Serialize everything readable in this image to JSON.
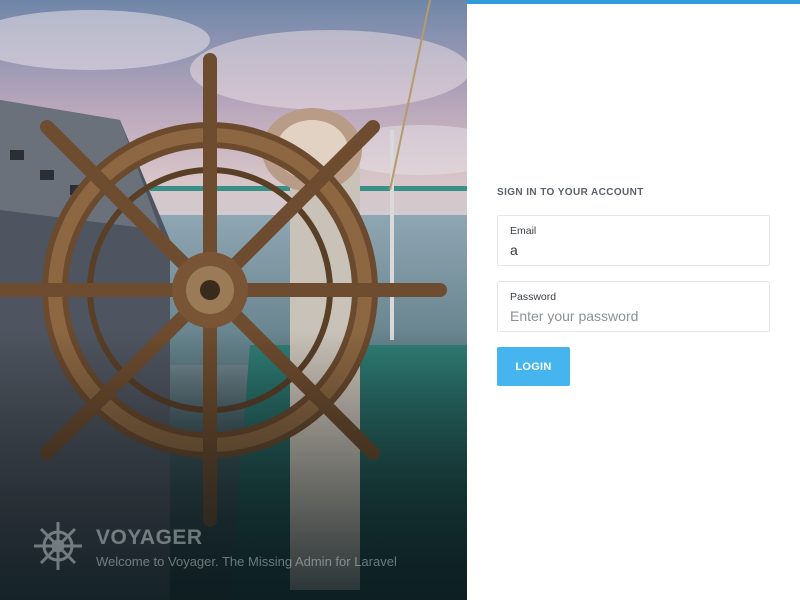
{
  "hero": {
    "image": "ship-helm-wheel-photo",
    "brand": {
      "logo_icon": "ship-wheel-icon",
      "title": "VOYAGER",
      "tagline": "Welcome to Voyager. The Missing Admin for Laravel"
    }
  },
  "login": {
    "accent_color": "#2f9bd8",
    "heading": "SIGN IN TO YOUR ACCOUNT",
    "email": {
      "label": "Email",
      "value": "a",
      "placeholder": ""
    },
    "password": {
      "label": "Password",
      "value": "",
      "placeholder": "Enter your password"
    },
    "submit_label": "LOGIN",
    "button_color": "#45b4ef"
  }
}
